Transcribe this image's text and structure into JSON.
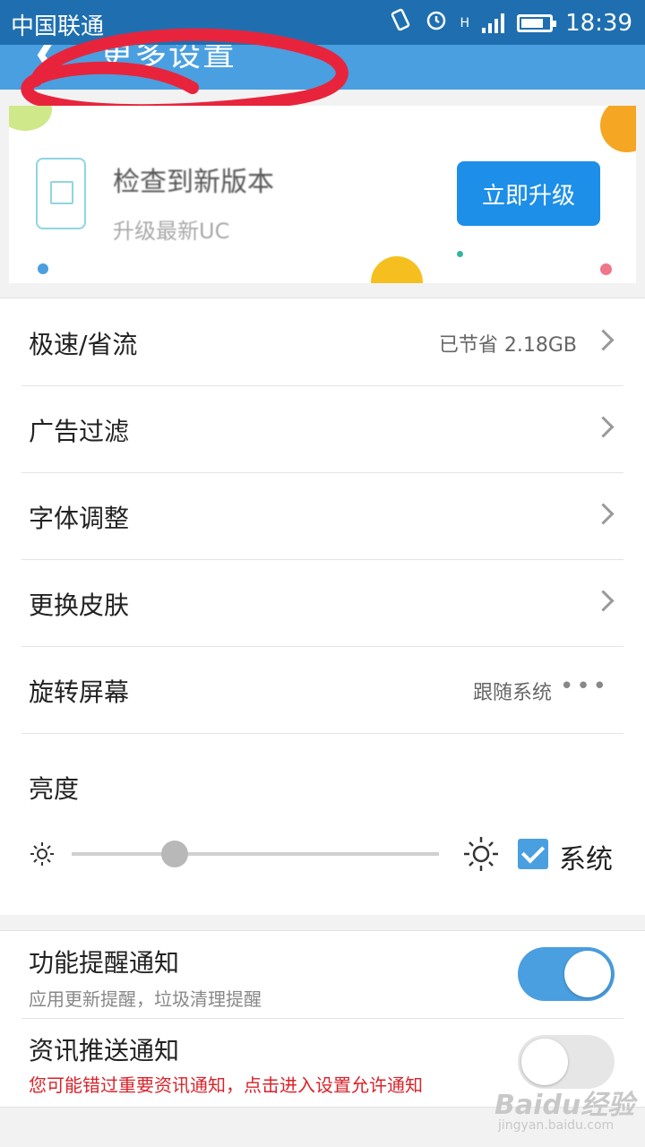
{
  "status_bar": {
    "carrier": "中国联通",
    "time": "18:39",
    "network": "H",
    "battery_level": 0.8
  },
  "header": {
    "back_icon": "chevron-left-icon",
    "title": "更多设置"
  },
  "banner": {
    "title": "检查到新版本",
    "subtitle": "升级最新UC",
    "button_label": "立即升级"
  },
  "settings": {
    "speed_saver": {
      "label": "极速/省流",
      "value": "已节省 2.18GB"
    },
    "ad_filter": {
      "label": "广告过滤"
    },
    "font_size": {
      "label": "字体调整"
    },
    "skin": {
      "label": "更换皮肤"
    },
    "rotate": {
      "label": "旋转屏幕",
      "value": "跟随系统"
    },
    "brightness": {
      "label": "亮度",
      "level": 0.28,
      "system_label": "系统",
      "system_checked": true
    }
  },
  "notifications": {
    "feature": {
      "title": "功能提醒通知",
      "subtitle": "应用更新提醒，垃圾清理提醒",
      "enabled": true
    },
    "news": {
      "title": "资讯推送通知",
      "warning": "您可能错过重要资讯通知，点击进入设置允许通知",
      "enabled": false
    }
  },
  "watermark": {
    "text": "Baidu经验",
    "sub": "jingyan.baidu.com"
  },
  "colors": {
    "status_bar": "#1f6fb0",
    "app_bar": "#4a9fe0",
    "accent": "#4a9fe0",
    "warning": "#d9232a",
    "scribble": "#e8243c"
  }
}
